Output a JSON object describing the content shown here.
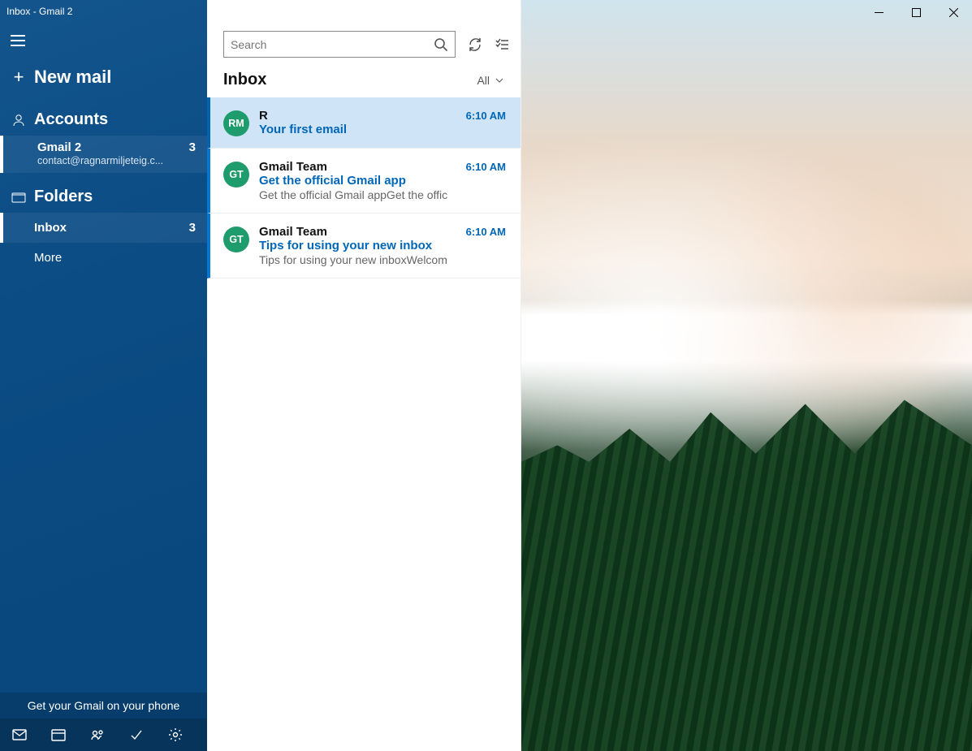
{
  "window": {
    "title": "Inbox - Gmail 2"
  },
  "sidebar": {
    "newMail": "New mail",
    "accountsHeading": "Accounts",
    "account": {
      "name": "Gmail 2",
      "email": "contact@ragnarmiljeteig.c...",
      "badge": "3"
    },
    "foldersHeading": "Folders",
    "inbox": {
      "label": "Inbox",
      "badge": "3"
    },
    "more": "More",
    "promo": "Get your Gmail on your phone"
  },
  "list": {
    "searchPlaceholder": "Search",
    "header": "Inbox",
    "filterLabel": "All"
  },
  "messages": [
    {
      "avatarInitials": "RM",
      "avatarColor": "#1f9c6d",
      "sender": "R",
      "subject": "Your first email",
      "preview": "",
      "time": "6:10 AM",
      "selected": true
    },
    {
      "avatarInitials": "GT",
      "avatarColor": "#1f9c6d",
      "sender": "Gmail Team",
      "subject": "Get the official Gmail app",
      "preview": "Get the official Gmail appGet the offic",
      "time": "6:10 AM",
      "selected": false
    },
    {
      "avatarInitials": "GT",
      "avatarColor": "#1f9c6d",
      "sender": "Gmail Team",
      "subject": "Tips for using your new inbox",
      "preview": "Tips for using your new inboxWelcom",
      "time": "6:10 AM",
      "selected": false
    }
  ]
}
